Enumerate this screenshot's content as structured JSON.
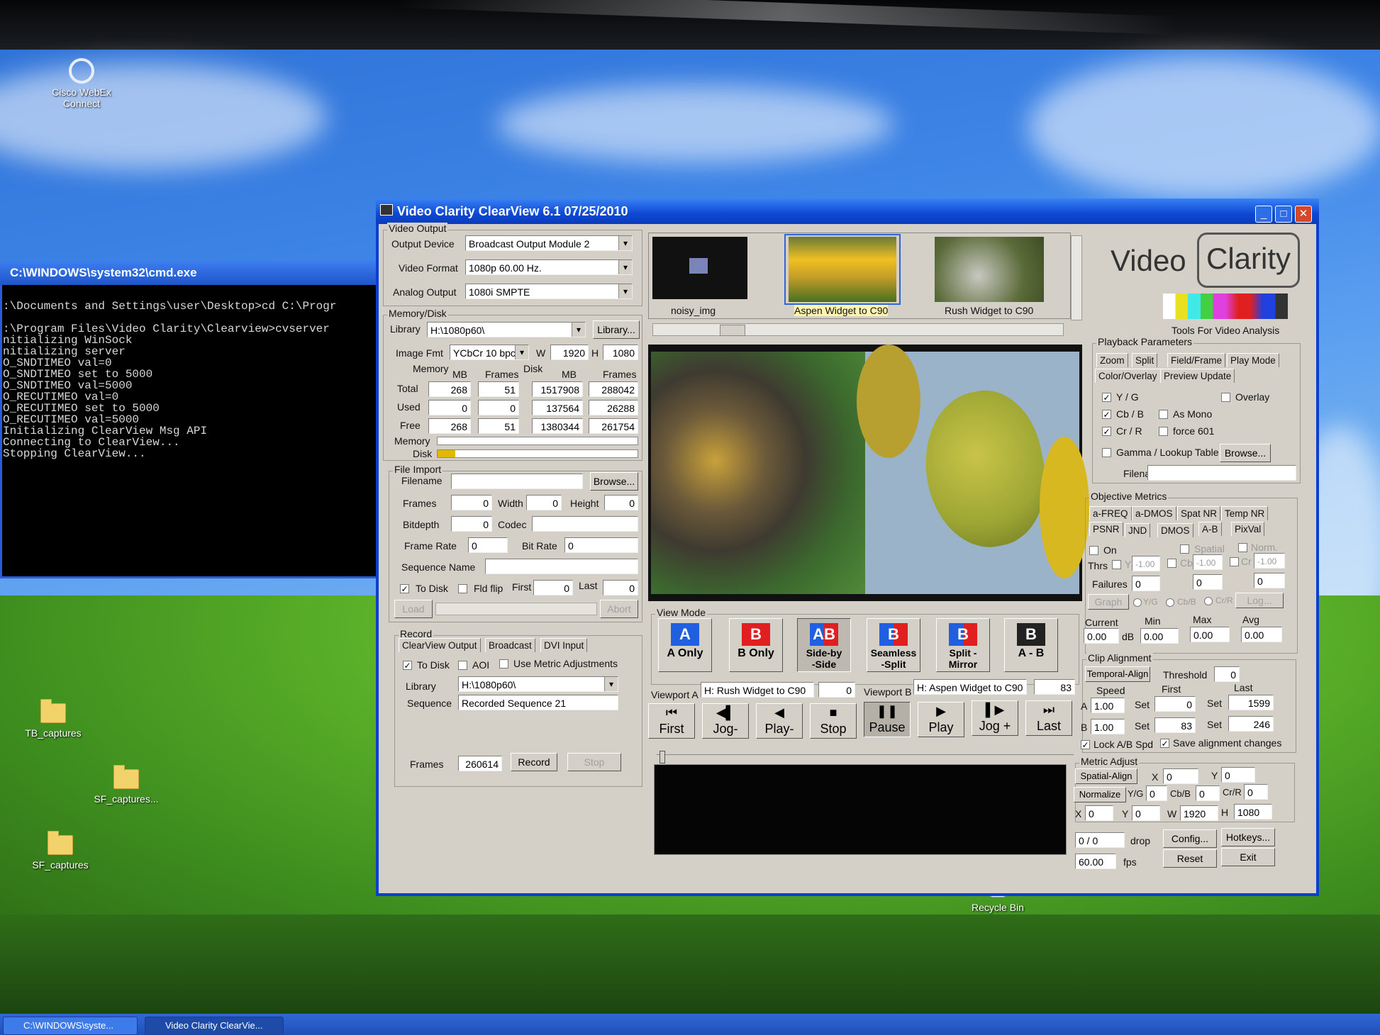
{
  "desktop": {
    "icons": [
      {
        "label": "Cisco WebEx\nConnect"
      },
      {
        "label": "TB_captures"
      },
      {
        "label": "SF_captures..."
      },
      {
        "label": "SF_captures"
      },
      {
        "label": "Recycle Bin"
      }
    ]
  },
  "cmd": {
    "title": "C:\\WINDOWS\\system32\\cmd.exe",
    "lines": ":\\Documents and Settings\\user\\Desktop>cd C:\\Progr\n\n:\\Program Files\\Video Clarity\\Clearview>cvserver\nnitializing WinSock\nnitializing server\nO_SNDTIMEO val=0\nO_SNDTIMEO set to 5000\nO_SNDTIMEO val=5000\nO_RECUTIMEO val=0\nO_RECUTIMEO set to 5000\nO_RECUTIMEO val=5000\nInitializing ClearView Msg API\nConnecting to ClearView...\nStopping ClearView..."
  },
  "window": {
    "title": "Video Clarity ClearView 6.1 07/25/2010",
    "minimize": "_",
    "maximize": "□",
    "close": "✕"
  },
  "video_output": {
    "group": "Video Output",
    "device_label": "Output Device",
    "device": "Broadcast Output Module 2",
    "format_label": "Video Format",
    "format": "1080p 60.00 Hz.",
    "analog_label": "Analog Output",
    "analog": "1080i SMPTE"
  },
  "memory_disk": {
    "group": "Memory/Disk",
    "library_label": "Library",
    "library": "H:\\1080p60\\",
    "library_btn": "Library...",
    "image_fmt_label": "Image Fmt",
    "image_fmt": "YCbCr 10 bpc",
    "w_label": "W",
    "w": "1920",
    "h_label": "H",
    "h": "1080",
    "memory_label": "Memory",
    "disk_label": "Disk",
    "cols": [
      "MB",
      "Frames",
      "MB",
      "Frames"
    ],
    "rows": [
      {
        "label": "Total",
        "values": [
          "268",
          "51",
          "1517908",
          "288042"
        ]
      },
      {
        "label": "Used",
        "values": [
          "0",
          "0",
          "137564",
          "26288"
        ]
      },
      {
        "label": "Free",
        "values": [
          "268",
          "51",
          "1380344",
          "261754"
        ]
      }
    ],
    "bar_memory_label": "Memory",
    "bar_disk_label": "Disk",
    "memory_fill": 0.0,
    "disk_fill": 0.09
  },
  "file_import": {
    "group": "File Import",
    "filename_label": "Filename",
    "filename": "",
    "browse": "Browse...",
    "frames_label": "Frames",
    "frames": "0",
    "width_label": "Width",
    "width": "0",
    "height_label": "Height",
    "height": "0",
    "bitdepth_label": "Bitdepth",
    "bitdepth": "0",
    "codec_label": "Codec",
    "codec": "",
    "framerate_label": "Frame Rate",
    "framerate": "0",
    "bitrate_label": "Bit Rate",
    "bitrate": "0",
    "seqname_label": "Sequence Name",
    "seqname": "",
    "todisk_label": "To Disk",
    "fldflip_label": "Fld flip",
    "first_label": "First",
    "first": "0",
    "last_label": "Last",
    "last": "0",
    "load": "Load",
    "abort": "Abort"
  },
  "record": {
    "group": "Record",
    "tabs": [
      "ClearView Output",
      "Broadcast",
      "DVI Input"
    ],
    "todisk_label": "To Disk",
    "aoi_label": "AOI",
    "metric_label": "Use Metric Adjustments",
    "library_label": "Library",
    "library": "H:\\1080p60\\",
    "sequence_label": "Sequence",
    "sequence": "Recorded Sequence 21",
    "frames_label": "Frames",
    "frames": "260614",
    "record_btn": "Record",
    "stop_btn": "Stop"
  },
  "clips": [
    {
      "label": "noisy_img"
    },
    {
      "label": "Aspen Widget to C90"
    },
    {
      "label": "Rush Widget to C90"
    }
  ],
  "view_mode": {
    "group": "View Mode",
    "buttons": [
      {
        "icon": "A",
        "label": "A Only"
      },
      {
        "icon": "B",
        "label": "B Only"
      },
      {
        "icon": "AB",
        "label": "Side-by\n-Side"
      },
      {
        "icon": "B",
        "label": "Seamless\n-Split"
      },
      {
        "icon": "B",
        "label": "Split -\nMirror"
      },
      {
        "icon": "B",
        "label": "A - B"
      }
    ]
  },
  "viewports": {
    "a_label": "Viewport A",
    "a_clip": "H: Rush Widget to C90",
    "a_frame": "0",
    "b_label": "Viewport B",
    "b_clip": "H: Aspen Widget to C90",
    "b_frame": "83"
  },
  "transport": [
    {
      "icon": "⏮",
      "label": "First"
    },
    {
      "icon": "◀▌",
      "label": "Jog-"
    },
    {
      "icon": "◀",
      "label": "Play-"
    },
    {
      "icon": "■",
      "label": "Stop"
    },
    {
      "icon": "❚❚",
      "label": "Pause"
    },
    {
      "icon": "▶",
      "label": "Play"
    },
    {
      "icon": "▌▶",
      "label": "Jog +"
    },
    {
      "icon": "⏭",
      "label": "Last"
    }
  ],
  "logo": {
    "video": "Video",
    "clarity": "Clarity",
    "tagline": "Tools For Video Analysis"
  },
  "playback": {
    "group": "Playback Parameters",
    "tabs_row1": [
      "Zoom",
      "Split",
      "Field/Frame",
      "Play Mode"
    ],
    "tabs_row2": [
      "Color/Overlay",
      "Preview Update"
    ],
    "yg": "Y / G",
    "cbb": "Cb / B",
    "crr": "Cr / R",
    "overlay": "Overlay",
    "asmono": "As Mono",
    "force": "force 601",
    "gamma": "Gamma / Lookup Table",
    "browse": "Browse...",
    "filename_label": "Filename"
  },
  "metrics": {
    "group": "Objective Metrics",
    "tabs_row1": [
      "a-FREQ",
      "a-DMOS",
      "Spat NR",
      "Temp NR"
    ],
    "tabs_row2": [
      "PSNR",
      "JND",
      "DMOS",
      "A-B",
      "PixVal"
    ],
    "on": "On",
    "spatial": "Spatial",
    "norm": "Norm.",
    "thrs": "Thrs",
    "y": "Y",
    "cb": "Cb",
    "cr": "Cr",
    "thr_y": "-1.00",
    "thr_cb": "-1.00",
    "thr_cr": "-1.00",
    "failures_label": "Failures",
    "failures": [
      "0",
      "0",
      "0"
    ],
    "graph": "Graph",
    "r_yg": "Y/G",
    "r_cbb": "Cb/B",
    "r_crr": "Cr/R",
    "log": "Log...",
    "current_label": "Current",
    "min_label": "Min",
    "max_label": "Max",
    "avg_label": "Avg",
    "db": "dB",
    "current": "0.00",
    "min": "0.00",
    "max": "0.00",
    "avg": "0.00"
  },
  "clip_align": {
    "group": "Clip Alignment",
    "temporal": "Temporal-Align",
    "threshold_label": "Threshold",
    "threshold": "0",
    "speed_label": "Speed",
    "first_label": "First",
    "last_label": "Last",
    "a_label": "A",
    "a_speed": "1.00",
    "a_first": "0",
    "a_last": "1599",
    "b_label": "B",
    "b_speed": "1.00",
    "b_first": "83",
    "b_last": "246",
    "set": "Set",
    "lock": "Lock A/B Spd",
    "save": "Save alignment changes"
  },
  "metric_adjust": {
    "group": "Metric Adjust",
    "spatial": "Spatial-Align",
    "x_label": "X",
    "x": "0",
    "y_label": "Y",
    "y": "0",
    "normalize": "Normalize",
    "yg_label": "Y/G",
    "yg": "0",
    "cbb_label": "Cb/B",
    "cbb": "0",
    "crr_label": "Cr/R",
    "crr": "0",
    "x2": "0",
    "y2": "0",
    "w_label": "W",
    "w": "1920",
    "h_label": "H",
    "h": "1080"
  },
  "status": {
    "drop_val": "0 / 0",
    "drop": "drop",
    "fps_val": "60.00",
    "fps": "fps",
    "config": "Config...",
    "hotkeys": "Hotkeys...",
    "reset": "Reset",
    "exit": "Exit"
  },
  "taskbar": {
    "items": [
      "C:\\WINDOWS\\syste...",
      "Video Clarity ClearVie..."
    ]
  }
}
